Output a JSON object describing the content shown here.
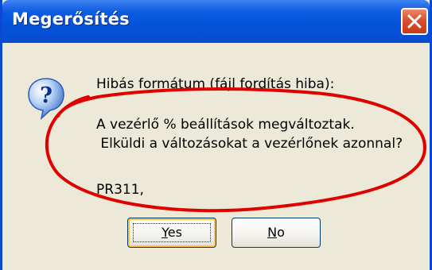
{
  "dialog": {
    "title": "Megerősítés",
    "icon": "question-icon",
    "close_icon": "close-icon",
    "message": {
      "line1": "Hibás formátum (fájl fordítás hiba):",
      "line2": "A vezérlő % beállítások megváltoztak.",
      "line3": " Elküldi a változásokat a vezérlőnek azonnal?",
      "line4": "PR311,"
    },
    "buttons": {
      "yes_mnemonic": "Y",
      "yes_rest": "es",
      "no_mnemonic": "N",
      "no_rest": "o"
    },
    "annotation_color": "#e00000"
  }
}
